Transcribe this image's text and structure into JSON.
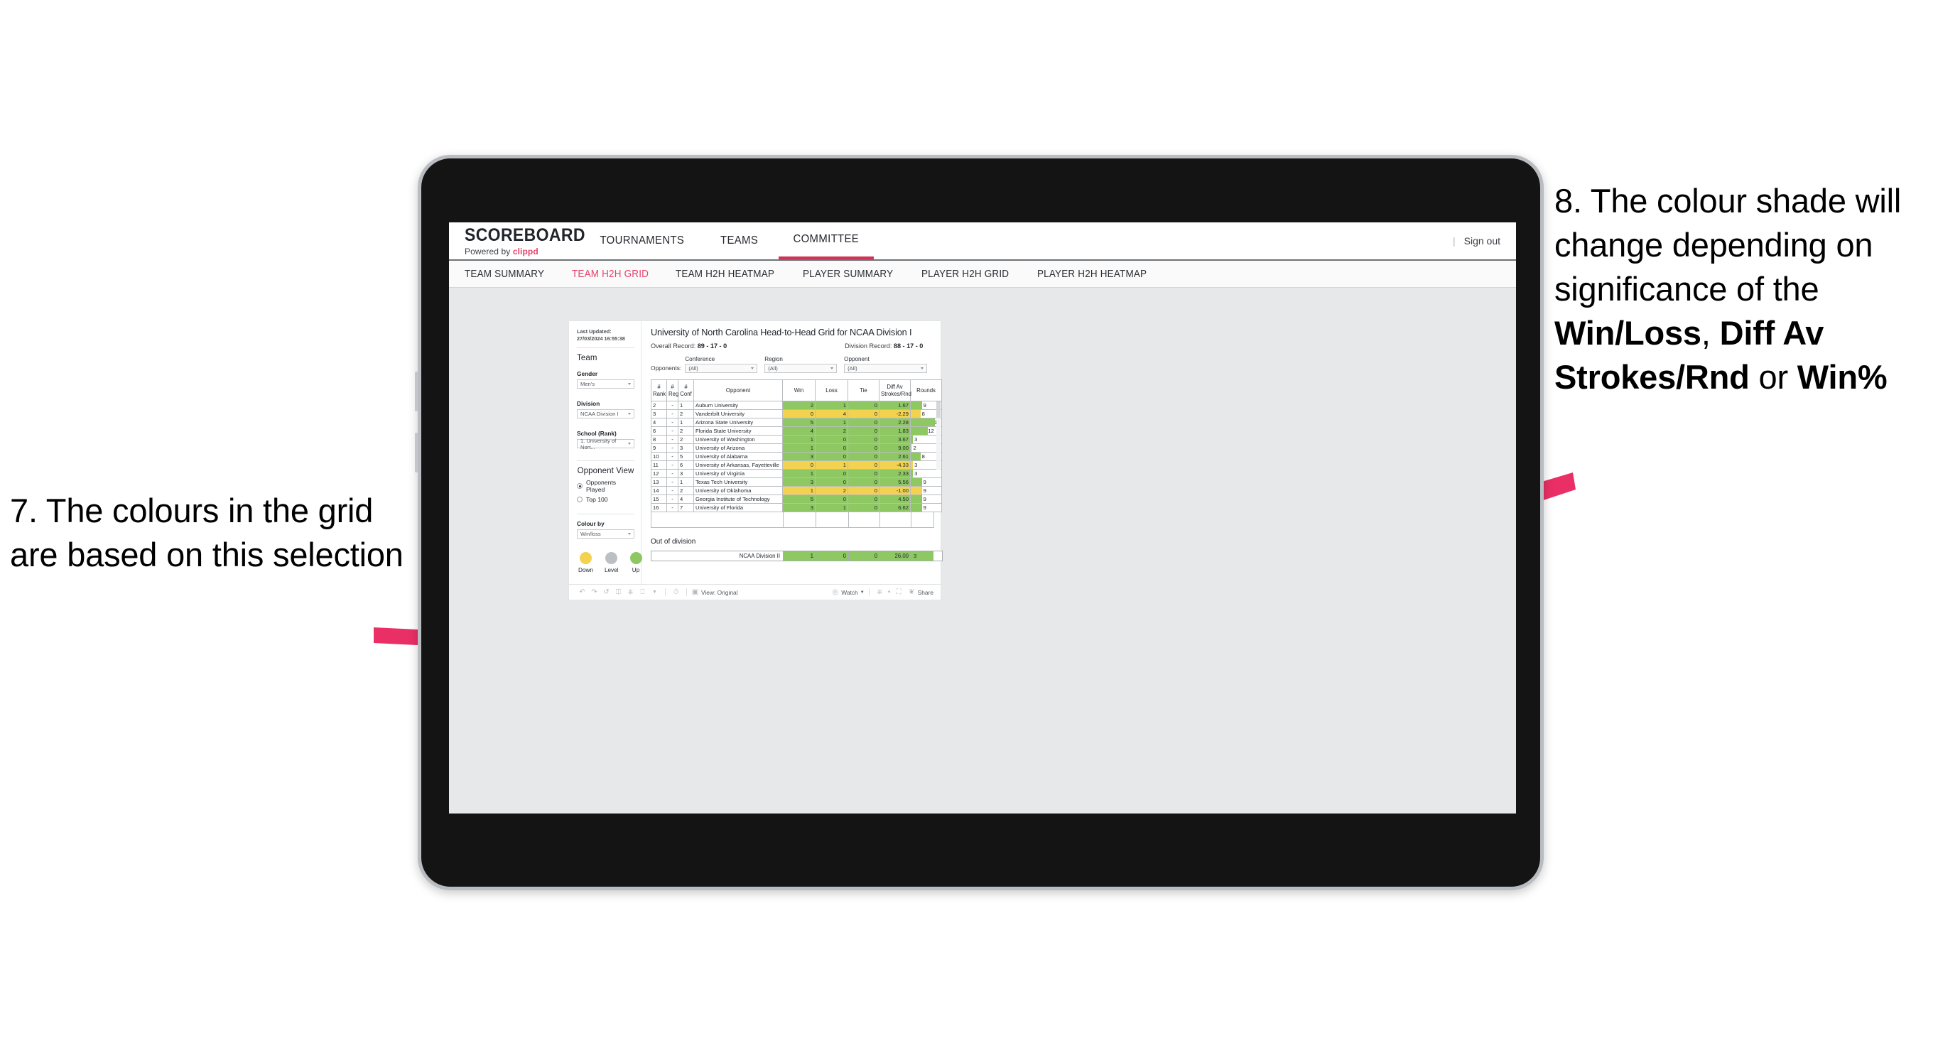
{
  "annotations": {
    "left": {
      "number": "7.",
      "text": "7. The colours in the grid are based on this selection"
    },
    "right": {
      "number": "8.",
      "line1": "8. The colour shade will change depending on significance of the ",
      "bold1": "Win/Loss",
      "mid1": ", ",
      "bold2": "Diff Av Strokes/Rnd",
      "mid2": " or ",
      "bold3": "Win%"
    },
    "arrow_color": "#EA2F66"
  },
  "app": {
    "brand": {
      "title": "SCOREBOARD",
      "powered_prefix": "Powered by ",
      "powered_name": "clippd"
    },
    "nav": [
      {
        "label": "TOURNAMENTS",
        "active": false
      },
      {
        "label": "TEAMS",
        "active": false
      },
      {
        "label": "COMMITTEE",
        "active": true
      }
    ],
    "header_right": {
      "separator": "|",
      "sign_out": "Sign out"
    },
    "subnav": [
      {
        "label": "TEAM SUMMARY",
        "active": false
      },
      {
        "label": "TEAM H2H GRID",
        "active": true
      },
      {
        "label": "TEAM H2H HEATMAP",
        "active": false
      },
      {
        "label": "PLAYER SUMMARY",
        "active": false
      },
      {
        "label": "PLAYER H2H GRID",
        "active": false
      },
      {
        "label": "PLAYER H2H HEATMAP",
        "active": false
      }
    ]
  },
  "panel": {
    "last_updated_label": "Last Updated:",
    "last_updated_value": "27/03/2024 16:55:38",
    "team_heading": "Team",
    "gender_label": "Gender",
    "gender_value": "Men's",
    "division_label": "Division",
    "division_value": "NCAA Division I",
    "school_label": "School (Rank)",
    "school_value": "1. University of Nort...",
    "opponent_view_heading": "Opponent View",
    "opponent_options": [
      {
        "label": "Opponents Played",
        "selected": true
      },
      {
        "label": "Top 100",
        "selected": false
      }
    ],
    "colour_by_label": "Colour by",
    "colour_by_value": "Win/loss",
    "legend": [
      {
        "label": "Down",
        "color": "#F2D24F"
      },
      {
        "label": "Level",
        "color": "#BCC0C4"
      },
      {
        "label": "Up",
        "color": "#8DC862"
      }
    ]
  },
  "view": {
    "title": "University of North Carolina Head-to-Head Grid for NCAA Division I",
    "overall_record_label": "Overall Record: ",
    "overall_record_value": "89 - 17 - 0",
    "division_record_label": "Division Record: ",
    "division_record_value": "88 - 17 - 0",
    "opponents_label": "Opponents:",
    "filters": [
      {
        "label": "Conference",
        "value": "(All)"
      },
      {
        "label": "Region",
        "value": "(All)"
      },
      {
        "label": "Opponent",
        "value": "(All)"
      }
    ],
    "out_of_division_title": "Out of division",
    "out_of_division_row": {
      "name": "NCAA Division II",
      "win": "1",
      "loss": "0",
      "tie": "0",
      "diff": "26.00",
      "rounds": "3",
      "color": "#8DC862",
      "rounds_bar_pct": 72
    }
  },
  "chart_data": {
    "type": "table",
    "title": "University of North Carolina Head-to-Head Grid for NCAA Division I",
    "columns": [
      "# Rank",
      "# Reg",
      "# Conf",
      "Opponent",
      "Win",
      "Loss",
      "Tie",
      "Diff Av Strokes/Rnd",
      "Rounds"
    ],
    "colour_by": "Win/loss",
    "colour_scale": {
      "down": "#F2D24F",
      "level": "#BCC0C4",
      "up": "#8DC862"
    },
    "rows": [
      {
        "rank": "2",
        "reg": "-",
        "conf": "1",
        "opponent": "Auburn University",
        "win": "2",
        "loss": "1",
        "tie": "0",
        "diff": "1.67",
        "rounds": "9",
        "color": "#8DC862",
        "rounds_bar_pct": 38
      },
      {
        "rank": "3",
        "reg": "-",
        "conf": "2",
        "opponent": "Vanderbilt University",
        "win": "0",
        "loss": "4",
        "tie": "0",
        "diff": "-2.29",
        "rounds": "8",
        "color": "#F2D24F",
        "rounds_bar_pct": 33
      },
      {
        "rank": "4",
        "reg": "-",
        "conf": "1",
        "opponent": "Arizona State University",
        "win": "5",
        "loss": "1",
        "tie": "0",
        "diff": "2.28",
        "rounds": "17",
        "color": "#8DC862",
        "rounds_bar_pct": 78
      },
      {
        "rank": "6",
        "reg": "-",
        "conf": "2",
        "opponent": "Florida State University",
        "win": "4",
        "loss": "2",
        "tie": "0",
        "diff": "1.83",
        "rounds": "12",
        "color": "#8DC862",
        "rounds_bar_pct": 55
      },
      {
        "rank": "8",
        "reg": "-",
        "conf": "2",
        "opponent": "University of Washington",
        "win": "1",
        "loss": "0",
        "tie": "0",
        "diff": "3.67",
        "rounds": "3",
        "color": "#8DC862",
        "rounds_bar_pct": 6
      },
      {
        "rank": "9",
        "reg": "-",
        "conf": "3",
        "opponent": "University of Arizona",
        "win": "1",
        "loss": "0",
        "tie": "0",
        "diff": "9.00",
        "rounds": "2",
        "color": "#8DC862",
        "rounds_bar_pct": 2
      },
      {
        "rank": "10",
        "reg": "-",
        "conf": "5",
        "opponent": "University of Alabama",
        "win": "3",
        "loss": "0",
        "tie": "0",
        "diff": "2.61",
        "rounds": "8",
        "color": "#8DC862",
        "rounds_bar_pct": 33
      },
      {
        "rank": "11",
        "reg": "-",
        "conf": "6",
        "opponent": "University of Arkansas, Fayetteville",
        "win": "0",
        "loss": "1",
        "tie": "0",
        "diff": "-4.33",
        "rounds": "3",
        "color": "#F2D24F",
        "rounds_bar_pct": 6
      },
      {
        "rank": "12",
        "reg": "-",
        "conf": "3",
        "opponent": "University of Virginia",
        "win": "1",
        "loss": "0",
        "tie": "0",
        "diff": "2.33",
        "rounds": "3",
        "color": "#8DC862",
        "rounds_bar_pct": 6
      },
      {
        "rank": "13",
        "reg": "-",
        "conf": "1",
        "opponent": "Texas Tech University",
        "win": "3",
        "loss": "0",
        "tie": "0",
        "diff": "5.56",
        "rounds": "9",
        "color": "#8DC862",
        "rounds_bar_pct": 38
      },
      {
        "rank": "14",
        "reg": "-",
        "conf": "2",
        "opponent": "University of Oklahoma",
        "win": "1",
        "loss": "2",
        "tie": "0",
        "diff": "-1.00",
        "rounds": "9",
        "color": "#F2D24F",
        "rounds_bar_pct": 38
      },
      {
        "rank": "15",
        "reg": "-",
        "conf": "4",
        "opponent": "Georgia Institute of Technology",
        "win": "5",
        "loss": "0",
        "tie": "0",
        "diff": "4.50",
        "rounds": "9",
        "color": "#8DC862",
        "rounds_bar_pct": 38
      },
      {
        "rank": "16",
        "reg": "-",
        "conf": "7",
        "opponent": "University of Florida",
        "win": "3",
        "loss": "1",
        "tie": "0",
        "diff": "6.62",
        "rounds": "9",
        "color": "#8DC862",
        "rounds_bar_pct": 38
      }
    ]
  },
  "toolbar": {
    "icons": [
      "undo-icon",
      "redo-icon",
      "revert-icon",
      "refresh-icon",
      "pause-icon",
      "shape-icon",
      "caret-down-icon",
      "history-icon"
    ],
    "view_icon": "view-icon",
    "view_label": "View: Original",
    "watch_label": "Watch",
    "download_icon": "download-icon",
    "fullscreen_icon": "fullscreen-icon",
    "share_label": "Share",
    "share_icon": "share-icon"
  }
}
